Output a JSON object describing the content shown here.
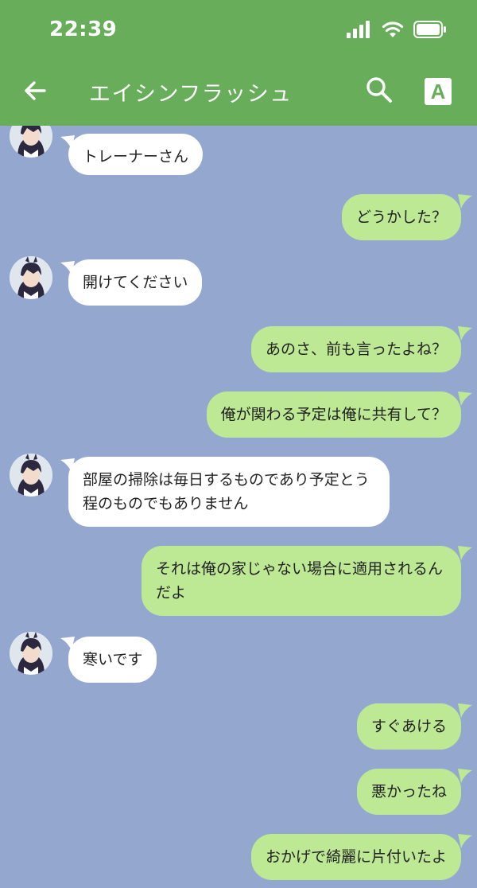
{
  "status_bar": {
    "time": "22:39"
  },
  "header": {
    "title": "エイシンフラッシュ",
    "font_button": "A"
  },
  "colors": {
    "header": "#68ad5a",
    "chat_bg": "#93a7cf",
    "incoming": "#ffffff",
    "outgoing": "#bde894"
  },
  "messages": [
    {
      "side": "in",
      "text": "トレーナーさん"
    },
    {
      "side": "out",
      "text": "どうかした？"
    },
    {
      "side": "in",
      "text": "開けてください"
    },
    {
      "side": "out",
      "text": "あのさ、前も言ったよね？"
    },
    {
      "side": "out",
      "text": "俺が関わる予定は俺に共有して？"
    },
    {
      "side": "in",
      "text": "部屋の掃除は毎日するものであり予定とう程のものでもありません"
    },
    {
      "side": "out",
      "text": "それは俺の家じゃない場合に適用されるんだよ"
    },
    {
      "side": "in",
      "text": "寒いです"
    },
    {
      "side": "out",
      "text": "すぐあける"
    },
    {
      "side": "out",
      "text": "悪かったね"
    },
    {
      "side": "out",
      "text": "おかげで綺麗に片付いたよ"
    }
  ]
}
